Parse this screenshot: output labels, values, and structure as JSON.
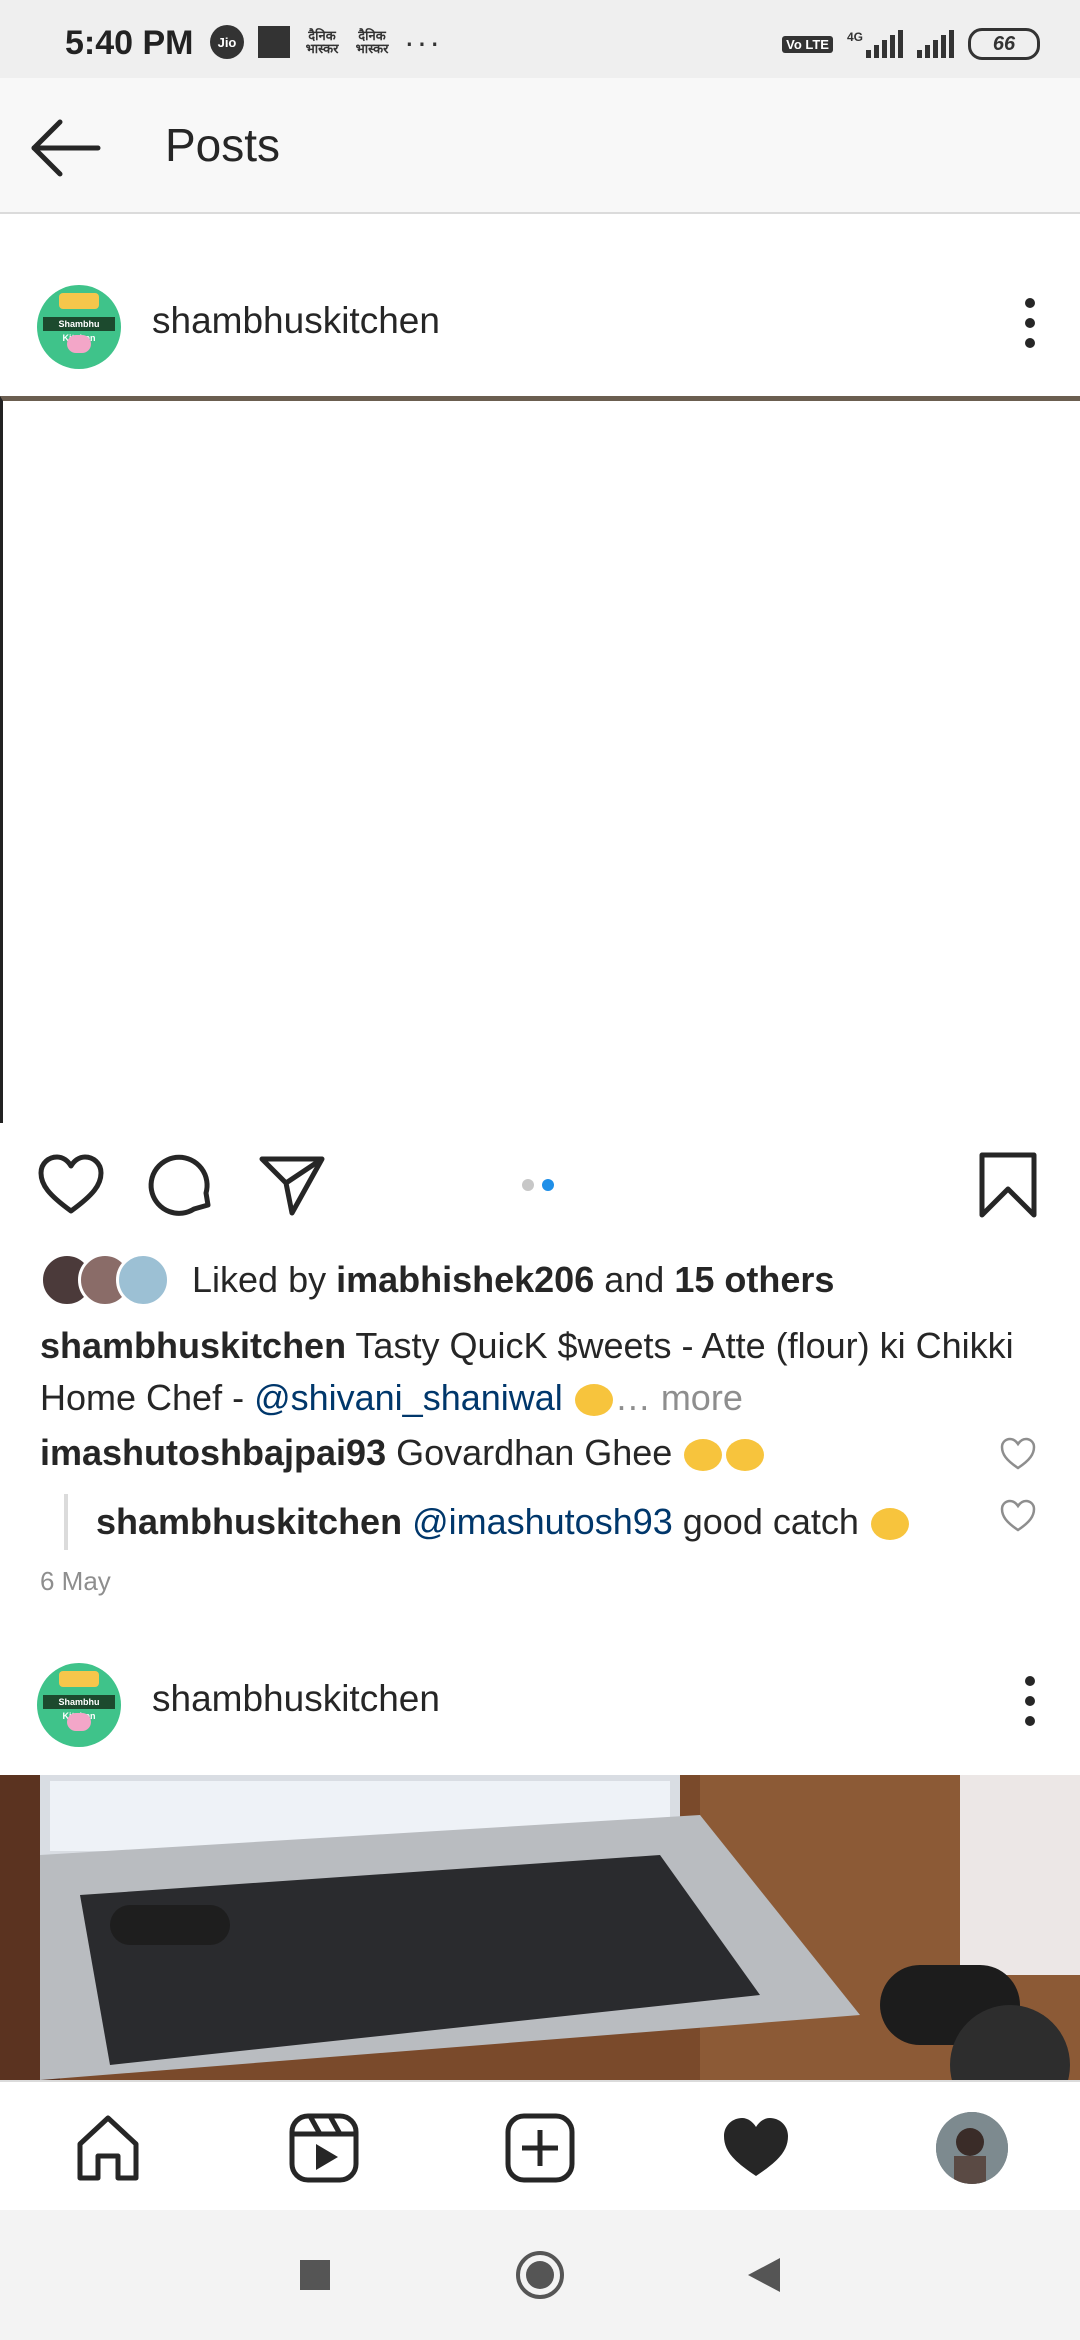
{
  "status_bar": {
    "time": "5:40 PM",
    "carrier_badge": "Jio",
    "app_badge_1": "दैनिक भास्कर",
    "app_badge_2": "दैनिक भास्कर",
    "overflow": "···",
    "volte": "Vo LTE",
    "network": "4G",
    "battery": "66"
  },
  "top_bar": {
    "title": "Posts",
    "back_icon": "arrow-left-icon"
  },
  "post1": {
    "username": "shambhuskitchen",
    "carousel_count": 2,
    "carousel_active_index": 1,
    "likes": {
      "prefix": "Liked by ",
      "user": "imabhishek206",
      "middle": " and ",
      "others": "15 others"
    },
    "caption": {
      "username": "shambhuskitchen",
      "text": " Tasty QuicK $weets - Atte (flour) ki Chikki Home Chef - ",
      "mention": "@shivani_shaniwal",
      "more": "… more"
    },
    "comment": {
      "username": "imashutoshbajpai93",
      "text": " Govardhan Ghee "
    },
    "reply": {
      "username": "shambhuskitchen",
      "mention": " @imashutosh93",
      "text": " good catch "
    },
    "date": "6 May"
  },
  "post2": {
    "username": "shambhuskitchen"
  },
  "bottom_nav": {
    "items": [
      "home-icon",
      "reels-icon",
      "new-post-icon",
      "activity-heart-icon",
      "profile-avatar"
    ]
  },
  "colors": {
    "accent_blue": "#1f8fe8",
    "mention_blue": "#00376b",
    "muted_gray": "#8e8e8e",
    "text": "#262626"
  }
}
